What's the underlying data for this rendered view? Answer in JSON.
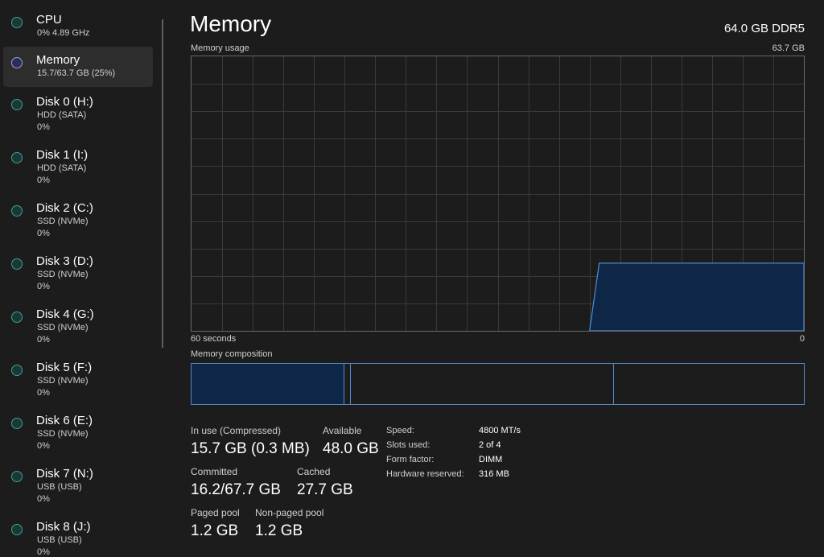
{
  "sidebar": {
    "items": [
      {
        "title": "CPU",
        "line1": "0% 4.89 GHz",
        "line2": ""
      },
      {
        "title": "Memory",
        "line1": "15.7/63.7 GB (25%)",
        "line2": ""
      },
      {
        "title": "Disk 0 (H:)",
        "line1": "HDD (SATA)",
        "line2": "0%"
      },
      {
        "title": "Disk 1 (I:)",
        "line1": "HDD (SATA)",
        "line2": "0%"
      },
      {
        "title": "Disk 2 (C:)",
        "line1": "SSD (NVMe)",
        "line2": "0%"
      },
      {
        "title": "Disk 3 (D:)",
        "line1": "SSD (NVMe)",
        "line2": "0%"
      },
      {
        "title": "Disk 4 (G:)",
        "line1": "SSD (NVMe)",
        "line2": "0%"
      },
      {
        "title": "Disk 5 (F:)",
        "line1": "SSD (NVMe)",
        "line2": "0%"
      },
      {
        "title": "Disk 6 (E:)",
        "line1": "SSD (NVMe)",
        "line2": "0%"
      },
      {
        "title": "Disk 7 (N:)",
        "line1": "USB (USB)",
        "line2": "0%"
      },
      {
        "title": "Disk 8 (J:)",
        "line1": "USB (USB)",
        "line2": "0%"
      }
    ],
    "selected_index": 1
  },
  "main": {
    "title": "Memory",
    "memory_type": "64.0 GB DDR5",
    "usage_label": "Memory usage",
    "usage_max": "63.7 GB",
    "time_left": "60 seconds",
    "time_right": "0",
    "composition_label": "Memory composition"
  },
  "usage_graph": {
    "max_gb": 63.7,
    "current_gb": 15.7,
    "history_fraction": 0.35
  },
  "composition": {
    "in_use_fraction": 0.25,
    "modified_fraction": 0.01,
    "standby_fraction": 0.43,
    "free_fraction": 0.31
  },
  "stats": {
    "in_use_label": "In use (Compressed)",
    "in_use_value": "15.7 GB (0.3 MB)",
    "available_label": "Available",
    "available_value": "48.0 GB",
    "committed_label": "Committed",
    "committed_value": "16.2/67.7 GB",
    "cached_label": "Cached",
    "cached_value": "27.7 GB",
    "paged_label": "Paged pool",
    "paged_value": "1.2 GB",
    "nonpaged_label": "Non-paged pool",
    "nonpaged_value": "1.2 GB"
  },
  "properties": {
    "speed_key": "Speed:",
    "speed_val": "4800 MT/s",
    "slots_key": "Slots used:",
    "slots_val": "2 of 4",
    "form_key": "Form factor:",
    "form_val": "DIMM",
    "hw_key": "Hardware reserved:",
    "hw_val": "316 MB"
  },
  "colors": {
    "accent": "#4d8fd8",
    "fill": "#0f2746",
    "grid": "#3a3a3a",
    "teal_dot": "#4a9a8e",
    "memory_dot": "#9aa0d6"
  }
}
